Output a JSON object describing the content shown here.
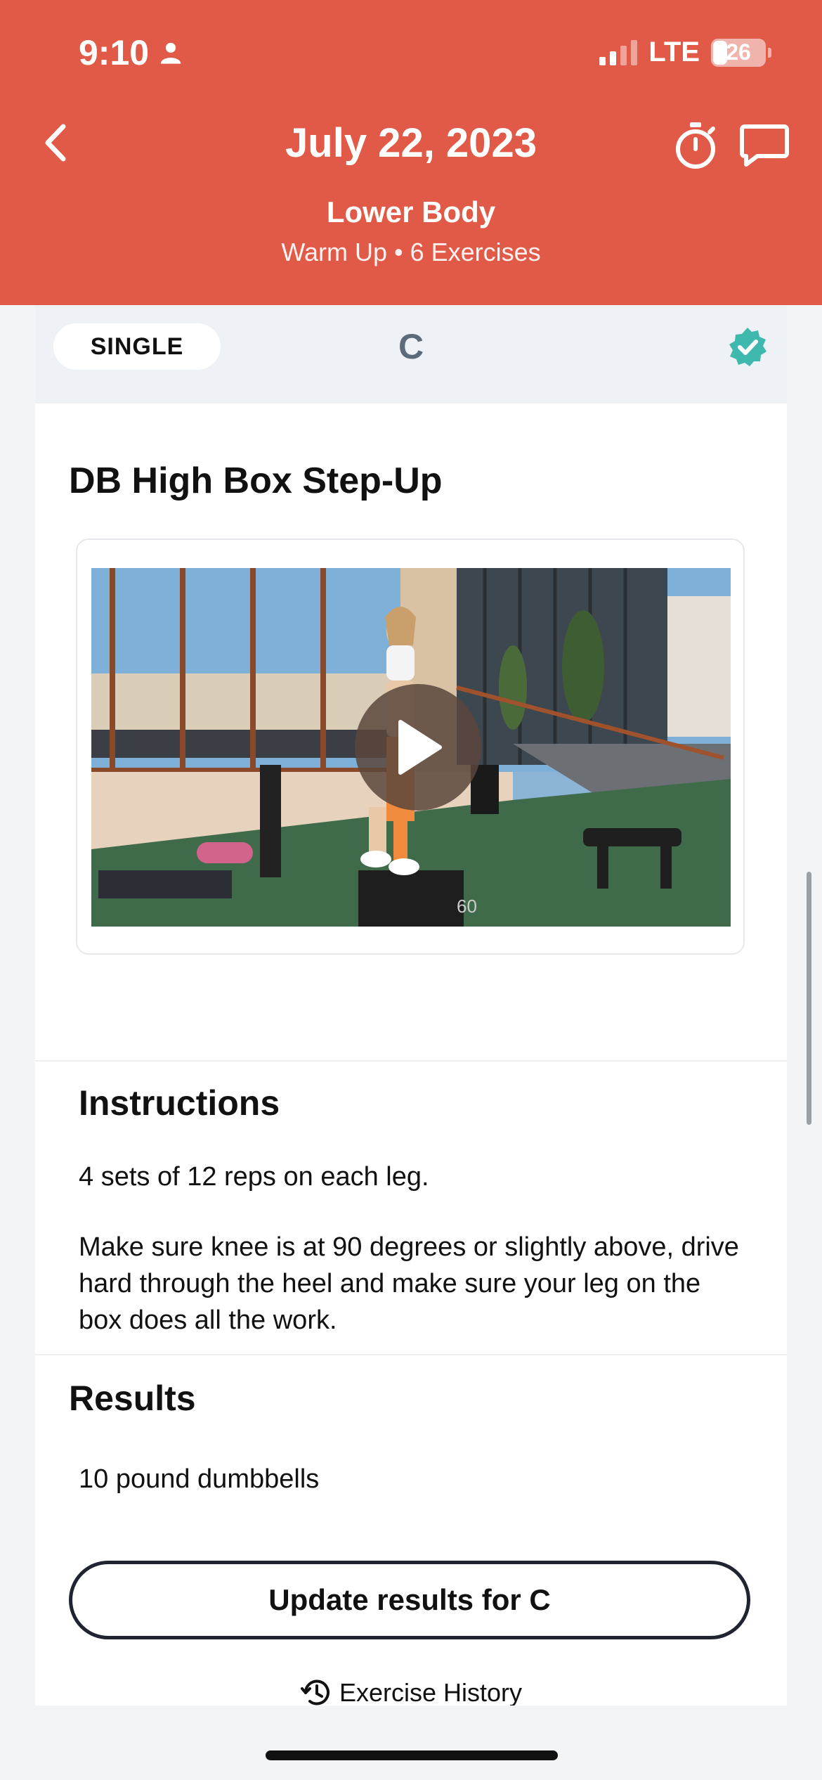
{
  "status_bar": {
    "time": "9:10",
    "network": "LTE",
    "battery_percent": "26"
  },
  "header": {
    "title": "July 22, 2023",
    "workout_name": "Lower Body",
    "meta": "Warm Up • 6 Exercises",
    "accent_color": "#e05a47"
  },
  "exercise_card": {
    "type_label": "SINGLE",
    "group_letter": "C",
    "completed": true,
    "name": "DB High Box Step-Up"
  },
  "instructions": {
    "heading": "Instructions",
    "line1": "4 sets of 12 reps on each leg.",
    "line2": "Make sure knee is at 90 degrees or slightly above, drive hard through the heel and make sure your leg on the box does all the work."
  },
  "results": {
    "heading": "Results",
    "value": "10 pound dumbbells",
    "update_button": "Update results for C",
    "history_link": "Exercise History"
  },
  "icons": {
    "back": "chevron-left-icon",
    "timer": "stopwatch-icon",
    "chat": "chat-bubble-icon",
    "check": "verified-check-icon",
    "play": "play-icon",
    "history": "history-clock-icon"
  }
}
